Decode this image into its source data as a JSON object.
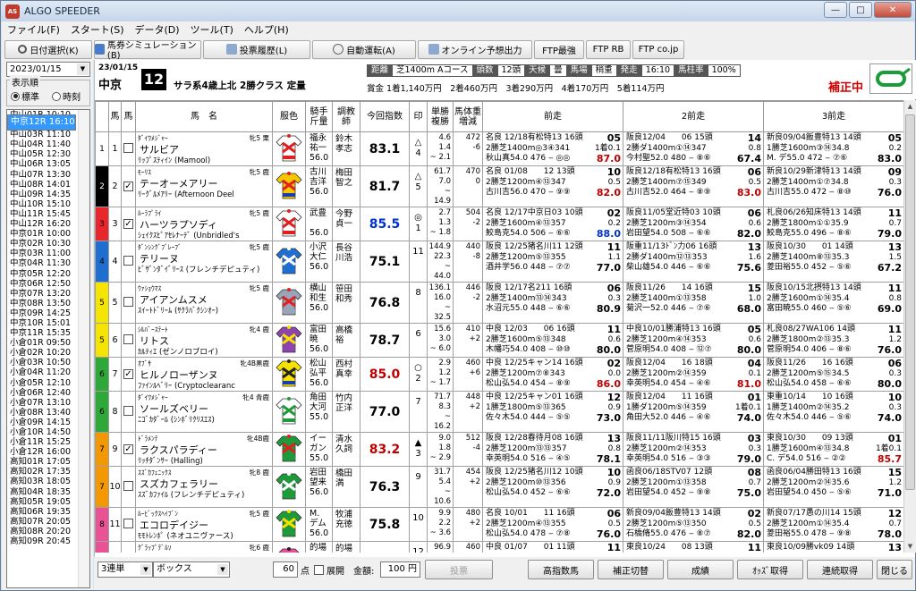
{
  "app": {
    "title": "ALGO SPEEDER",
    "icon_text": "AS"
  },
  "window_buttons": [
    "—",
    "□",
    "✕"
  ],
  "menu": [
    "ファイル(F)",
    "スタート(S)",
    "データ(D)",
    "ツール(T)",
    "ヘルプ(H)"
  ],
  "toolbar": [
    {
      "label": "日付選択(K)",
      "icon": "search-icon"
    },
    {
      "label": "馬券シミュレーション(B)",
      "icon": "table-icon"
    },
    {
      "label": "投票履歴(L)",
      "icon": "document-icon"
    },
    {
      "label": "自動運転(A)",
      "icon": "clock-icon"
    },
    {
      "label": "オンライン予想出力",
      "icon": "document-icon"
    },
    {
      "label": "FTP最強",
      "icon": ""
    },
    {
      "label": "FTP RB",
      "icon": ""
    },
    {
      "label": "FTP co.jp",
      "icon": ""
    }
  ],
  "left": {
    "date": "2023/01/15",
    "display_order_label": "表示順",
    "radio_standard": "標準",
    "radio_time": "時刻",
    "races": [
      "中山01R 10:10",
      "中山02R 10:40",
      "中山03R 11:10",
      "中山04R 11:40",
      "中山05R 12:30",
      "中山06R 13:05",
      "中山07R 13:30",
      "中山08R 14:01",
      "中山09R 14:35",
      "中山10R 15:10",
      "中山11R 15:45",
      "中山12R 16:20",
      "中京01R 10:00",
      "中京02R 10:30",
      "中京03R 11:00",
      "中京04R 11:30",
      "中京05R 12:20",
      "中京06R 12:50",
      "中京07R 13:20",
      "中京08R 13:50",
      "中京09R 14:25",
      "中京10R 15:01",
      "中京11R 15:35",
      "中京12R 16:10",
      "小倉01R 09:50",
      "小倉02R 10:20",
      "小倉03R 10:50",
      "小倉04R 11:20",
      "小倉05R 12:10",
      "小倉06R 12:40",
      "小倉07R 13:10",
      "小倉08R 13:40",
      "小倉09R 14:15",
      "小倉10R 14:50",
      "小倉11R 15:25",
      "小倉12R 16:00",
      "高知01R 17:05",
      "高知02R 17:35",
      "高知03R 18:05",
      "高知04R 18:35",
      "高知05R 19:05",
      "高知06R 19:35",
      "高知07R 20:05",
      "高知08R 20:20",
      "高知09R 20:45"
    ],
    "selected_index": 23
  },
  "race": {
    "date": "23/01/15",
    "place": "中京",
    "number": "12",
    "class": "サラ系4歳上北 2勝クラス 定量",
    "info": [
      {
        "t": "距離",
        "dark": true
      },
      {
        "t": "芝1400m Aコース",
        "dark": false
      },
      {
        "t": "頭数",
        "dark": true
      },
      {
        "t": "12頭",
        "dark": false
      },
      {
        "t": "天候",
        "dark": true
      },
      {
        "t": "曇",
        "dark": false
      },
      {
        "t": "馬場",
        "dark": true
      },
      {
        "t": "稍重",
        "dark": false
      },
      {
        "t": "発走",
        "dark": true
      },
      {
        "t": "16:10",
        "dark": false
      },
      {
        "t": "馬柱率",
        "dark": true
      },
      {
        "t": "100%",
        "dark": false
      }
    ],
    "prize": "賞金 1着1,140万円　2着460万円　3着290万円　4着170万円　5着114万円",
    "hosei": "補正中"
  },
  "columns": [
    "",
    "馬",
    "馬",
    "馬　名",
    "服色",
    "騎手\n斤量",
    "調教\n師",
    "今回指数",
    "印",
    "単勝\n複勝",
    "馬体重\n増減",
    "前走",
    "2前走",
    "3前走"
  ],
  "horses": [
    {
      "waku": "1",
      "num": "1",
      "chk": false,
      "sire": "ﾀﾞｲﾜﾒｼﾞｬｰ",
      "sex": "牝5 栗",
      "name": "サルビア",
      "sub": "ﾘｯﾌﾟｽﾃｨｲﾝ (Mamool)",
      "silk": "red-white",
      "jockey": "福永\n祐一\n56.0",
      "trainer": "鈴木\n孝志",
      "index": "83.1",
      "index_color": "pm",
      "mark": "△",
      "mark2": "4",
      "win": "4.6",
      "place": "1.4\n~ 2.1",
      "wt": "472\n-6",
      "p1": [
        "名良 12/18有松特13 16頭",
        "05",
        "2勝芝1400m◎3④341",
        "1着0.1",
        "秋山真54.0 476 ‒ ◎◎",
        "87.0"
      ],
      "p2": [
        "阪良12/04　　06 15頭",
        "14",
        "2勝ダ1400m①⑭347",
        "0.8",
        "今村聖52.0 480 ‒ ⑧⑥",
        "67.4"
      ],
      "p3": [
        "新良09/04飯豊特13 14頭",
        "05",
        "1勝芝1600m③⑭34.8",
        "0.2",
        "M. デ55.0 472 ‒ ⑦⑥",
        "83.0"
      ]
    },
    {
      "waku": "2",
      "num": "2",
      "chk": true,
      "sire": "ﾓｰﾘｽ",
      "sex": "牝5 鹿",
      "name": "テーオーメアリー",
      "sub": "ﾘｰｸﾞﾙﾒｱﾘｰ (Afternoon Deel",
      "silk": "yellow-red",
      "jockey": "古川\n吉洋\n56.0",
      "trainer": "梅田\n智之",
      "index": "81.7",
      "index_color": "pm",
      "mark": "△",
      "mark2": "5",
      "win": "61.7",
      "place": "7.0\n~ 14.9",
      "wt": "470\n0",
      "p1": [
        "名良 01/08　　12 13頭",
        "10",
        "2勝芝1200m④⑬347",
        "0.5",
        "古川吉56.0 470 ‒ ⑨⑨",
        "82.0"
      ],
      "p2": [
        "阪良12/18有松特13 16頭",
        "06",
        "2勝芝1400m⑦⑮349",
        "0.5",
        "古川吉52.0 464 ‒ ⑧⑨",
        "83.0"
      ],
      "p3": [
        "新良10/29新津特13 14頭",
        "09",
        "2勝芝1400m①⑦34.8",
        "0.3",
        "古川吉55.0 472 ‒ ⑧⑩",
        "76.0"
      ]
    },
    {
      "waku": "3",
      "num": "3",
      "chk": true,
      "sire": "ﾙｰﾗﾌﾟﾗｲ",
      "sex": "牝5 鹿",
      "name": "ハーツラプソディ",
      "sub": "ｼｪｲｸｽﾋﾟｱｾﾚﾅｰﾃﾞ (Unbridled's",
      "silk": "red-white-x",
      "jockey": "武豊\n\n56.0",
      "trainer": "今野\n貞一",
      "index": "85.5",
      "index_color": "bl",
      "mark": "◎",
      "mark2": "1",
      "win": "2.7",
      "place": "1.3\n~ 1.8",
      "wt": "504\n-2",
      "p1": [
        "名良 12/17中京日03 10頭",
        "02",
        "2勝芝1600m④⑬357",
        "0.2",
        "鮫島克54.0 506 ‒ ⑥⑥",
        "88.0"
      ],
      "p2": [
        "阪良11/05堂近特03 10頭",
        "06",
        "2勝芝1200m③⑭354",
        "0.6",
        "岩田望54.0 508 ‒ ⑥⑥",
        "82.0"
      ],
      "p3": [
        "札良06/26知床特13 14頭",
        "11",
        "2勝芝1800m①①35.9",
        "0.7",
        "鮫島克55.0 496 ‒ ⑧⑥",
        "79.0"
      ]
    },
    {
      "waku": "4",
      "num": "4",
      "chk": false,
      "sire": "ﾀﾞﾝｼﾝｸﾞﾌﾞﾚｰﾌﾞ",
      "sex": "牝5 鹿",
      "name": "テリーヌ",
      "sub": "ﾋﾞｻﾞﾝﾀﾞｲﾞﾘｰｽ (フレンチデピュティ)",
      "silk": "blue-white",
      "jockey": "小沢\n大仁\n56.0",
      "trainer": "長谷\n川浩",
      "index": "75.1",
      "index_color": "pm",
      "mark": "",
      "mark2": "11",
      "win": "144.9",
      "place": "22.3\n~ 44.0",
      "wt": "440\n-8",
      "p1": [
        "阪良 12/25猪名川11 12頭",
        "11",
        "2勝芝1200m⑤⑬355",
        "1.1",
        "酒井学56.0 448 ‒ ⑦⑦",
        "77.0"
      ],
      "p2": [
        "阪重11/13ﾄﾞﾝ力06 16頭",
        "13",
        "2勝ダ1400m⑫⑬353",
        "1.6",
        "柴山雄54.0 446 ‒ ⑥⑥",
        "75.6"
      ],
      "p3": [
        "阪良10/30　　01 14頭",
        "13",
        "2勝芝1400m⑧⑬35.3",
        "1.5",
        "菱田裕55.0 452 ‒ ⑤⑥",
        "67.2"
      ]
    },
    {
      "waku": "5",
      "num": "5",
      "chk": false,
      "sire": "ｳｧｼｮｳﾏｽ",
      "sex": "牝5 鹿",
      "name": "アイアンムスメ",
      "sub": "ｽｲｰﾄﾄﾞﾘｰﾑ (ｻｸﾗﾊﾞｸｼﾝｵｰ)",
      "silk": "grey-red",
      "jockey": "横山\n和生\n56.0",
      "trainer": "笹田\n和秀",
      "index": "76.8",
      "index_color": "pm",
      "mark": "",
      "mark2": "8",
      "win": "136.1",
      "place": "16.0\n~ 32.5",
      "wt": "446\n-2",
      "p1": [
        "阪良 12/17名211 16頭",
        "06",
        "2勝芝1400m⑬⑭343",
        "0.3",
        "水沼元55.0 448 ‒ ⑥⑥",
        "80.9"
      ],
      "p2": [
        "阪良11/26　　14 16頭",
        "15",
        "2勝芝1400m①⑬358",
        "1.0",
        "菊沢一52.0 446 ‒ ⑦⑥",
        "68.0"
      ],
      "p3": [
        "阪良10/15北摂特13 14頭",
        "11",
        "2勝芝1600m①⑭35.4",
        "0.8",
        "富田暁55.0 460 ‒ ⑤⑥",
        "69.0"
      ]
    },
    {
      "waku": "5",
      "num": "6",
      "chk": false,
      "sire": "ｼﾙﾊﾞｰｽﾃｰﾄ",
      "sex": "牝4 鹿",
      "name": "リトス",
      "sub": "ｶﾙﾃｨｴ (ゼンノロブロイ)",
      "silk": "purple-yellow",
      "jockey": "富田\n暁\n56.0",
      "trainer": "高橋\n裕",
      "index": "78.7",
      "index_color": "pm",
      "mark": "",
      "mark2": "6",
      "win": "15.6",
      "place": "3.0\n~ 6.0",
      "wt": "410\n+2",
      "p1": [
        "中良 12/03　　06 16頭",
        "11",
        "2勝芝1600m⑤⑬348",
        "0.6",
        "木幡巧54.0 408 ‒ ⑩⑩",
        "80.0"
      ],
      "p2": [
        "中良10/01勝浦特13 16頭",
        "05",
        "2勝芝1200m④⑭353",
        "0.6",
        "菅原明54.0 408 ‒ ⑫⑦",
        "80.0"
      ],
      "p3": [
        "札良08/27WA106 14頭",
        "11",
        "2勝芝1800m②⑬35.3",
        "1.2",
        "菅原明54.0 406 ‒ ⑧⑥",
        "76.0"
      ]
    },
    {
      "waku": "6",
      "num": "7",
      "chk": true,
      "sire": "ｵﾌﾞｻ",
      "sex": "牝4B黒鹿",
      "name": "ヒルノローザンヌ",
      "sub": "ﾌｧｲﾝﾙﾍﾞﾘｰ (Cryptoclearanc",
      "silk": "yellow-black",
      "jockey": "松山\n弘平\n56.0",
      "trainer": "西村\n真幸",
      "index": "85.0",
      "index_color": "rd",
      "mark": "○",
      "mark2": "2",
      "win": "2.9",
      "place": "1.2\n~ 1.7",
      "wt": "460\n+6",
      "p1": [
        "中良 12/25キャン14 16頭",
        "02",
        "2勝芝1200m⑦⑧343",
        "0.0",
        "松山弘54.0 454 ‒ ⑧⑨",
        "86.0"
      ],
      "p2": [
        "阪良12/04　　16 18頭",
        "04",
        "2勝芝1200m②⑭359",
        "0.1",
        "幸英明54.0 454 ‒ ④⑥",
        "81.0"
      ],
      "p3": [
        "阪良11/26　　16 16頭",
        "06",
        "2勝芝1200m⑤⑮34.5",
        "0.3",
        "松山弘54.0 458 ‒ ⑥⑥",
        "80.0"
      ]
    },
    {
      "waku": "6",
      "num": "8",
      "chk": false,
      "sire": "ﾀﾞｲﾜﾒｼﾞｬｰ",
      "sex": "牝4 青鹿",
      "name": "ソールズベリー",
      "sub": "ﾆｺﾞｶﾀﾞｰﾙ (ｼﾝﾎﾞﾘｸﾘｽｴｽ)",
      "silk": "green-white",
      "jockey": "角田\n大河\n55.0",
      "trainer": "竹内\n正洋",
      "index": "77.0",
      "index_color": "pm",
      "mark": "",
      "mark2": "7",
      "win": "71.7",
      "place": "8.3\n~ 16.2",
      "wt": "448\n+2",
      "p1": [
        "中良 12/25キャン01 16頭",
        "12",
        "1勝芝1800m⑤⑬365",
        "0.9",
        "佐々木54.0 444 ‒ ⑤⑤",
        "73.0"
      ],
      "p2": [
        "阪良12/04　　11 16頭",
        "01",
        "1勝ダ1200m⑤⑭359",
        "1着0.1",
        "角田大52.0 446 ‒ ④⑥",
        "74.0"
      ],
      "p3": [
        "東重10/14　　10 16頭",
        "10",
        "1勝芝1400m②⑭35.2",
        "0.3",
        "佐々木54.0 446 ‒ ⑤⑥",
        "74.0"
      ]
    },
    {
      "waku": "7",
      "num": "9",
      "chk": true,
      "sire": "ﾄﾞﾗﾒﾝﾃ",
      "sex": "牝4B鹿",
      "name": "ラクスパラディー",
      "sub": "ﾘｯﾁﾀﾞﾝｻｰ (Halling)",
      "silk": "green-red",
      "jockey": "イー\nガン\n55.0",
      "trainer": "清水\n久詞",
      "index": "83.2",
      "index_color": "rd",
      "mark": "▲",
      "mark2": "3",
      "win": "9.0",
      "place": "1.8\n~ 2.9",
      "wt": "512\n-4",
      "p1": [
        "阪良 12/28春待月08 16頭",
        "13",
        "2勝芝1200m⑬⑬357",
        "0.8",
        "幸英明54.0 516 ‒ ④⑤",
        "78.1"
      ],
      "p2": [
        "阪良11/11阪川特15 16頭",
        "03",
        "2勝芝1200m②⑭353",
        "0.3",
        "幸英明54.0 516 ‒ ③③",
        "79.0"
      ],
      "p3": [
        "東良10/30　　09 13頭",
        "01",
        "1勝芝1600m④⑬34.8",
        "1着0.1",
        "C. デ54.0 516 ‒ ②②",
        "85.7"
      ]
    },
    {
      "waku": "7",
      "num": "10",
      "chk": false,
      "sire": "ｽｽﾞｶﾌｪﾆｯｸｽ",
      "sex": "牝8 鹿",
      "name": "スズカフェラリー",
      "sub": "ｽｽﾞｶﾌｧｲﾙ (フレンチデピュティ)",
      "silk": "green-white2",
      "jockey": "岩田\n望来\n56.0",
      "trainer": "橋田\n満",
      "index": "76.3",
      "index_color": "pm",
      "mark": "",
      "mark2": "9",
      "win": "31.7",
      "place": "5.4\n~ 10.6",
      "wt": "454\n+2",
      "p1": [
        "阪良 12/25猪名川12 10頭",
        "10",
        "2勝芝1200m⑩⑬356",
        "0.9",
        "松山弘54.0 452 ‒ ⑥⑥",
        "72.0"
      ],
      "p2": [
        "函良06/18STV07 12頭",
        "08",
        "2勝芝1200m①⑬358",
        "0.7",
        "岩田望54.0 452 ‒ ⑨⑧",
        "75.0"
      ],
      "p3": [
        "函良06/04勝田特13 16頭",
        "15",
        "2勝芝1200m②⑭35.6",
        "1.2",
        "岩田望54.0 450 ‒ ⑤⑥",
        "71.0"
      ]
    },
    {
      "waku": "8",
      "num": "11",
      "chk": false,
      "sire": "ﾙｰﾋﾞｯｸｽﾍｲﾌﾞﾝ",
      "sex": "牝5 鹿",
      "name": "エコロデイジー",
      "sub": "ﾓﾓﾄﾚﾝﾎﾟ (ネオユニヴァース)",
      "silk": "green-yellow",
      "jockey": "M.\nデム\n56.0",
      "trainer": "牧浦\n充徳",
      "index": "75.8",
      "index_color": "pm",
      "mark": "",
      "mark2": "10",
      "win": "9.9",
      "place": "2.2\n~ 3.6",
      "wt": "480\n+2",
      "p1": [
        "名良 10/01　　11 16頭",
        "06",
        "2勝芝1200m④⑬355",
        "0.5",
        "松山弘54.0 478 ‒ ⑦⑧",
        "76.0"
      ],
      "p2": [
        "新良09/04飯豊特13 14頭",
        "02",
        "2勝芝1200m⑤⑬350",
        "0.5",
        "石橋脩55.0 476 ‒ ⑧⑦",
        "82.0"
      ],
      "p3": [
        "新良07/17愚の川14 15頭",
        "12",
        "2勝芝1200m①⑭35.4",
        "0.7",
        "菱田裕55.0 478 ‒ ⑨⑧",
        "78.0"
      ]
    },
    {
      "waku": "8",
      "num": "12",
      "chk": false,
      "sire": "ｸﾞﾗｯﾌﾟﾃﾞﾙｿ",
      "sex": "牝6 鹿",
      "name": "ミズリーナ",
      "sub": "ｶﾉﾝ (フォーティナイナーズサン)",
      "silk": "pink-black",
      "jockey": "的場\n勇人\n56.0",
      "trainer": "的場\n均",
      "index": "74.0",
      "index_color": "pm",
      "mark": "",
      "mark2": "12",
      "win": "96.9",
      "place": "13.9\n~ 25.7",
      "wt": "460\n+4",
      "p1": [
        "中良 01/07　　01 11頭",
        "11",
        "2勝芝1200m⑬⑬350",
        "0.9",
        "的場勇54.0 456 ‒ ⑪⑪",
        "77.0"
      ],
      "p2": [
        "東良10/24　　08 13頭",
        "11",
        "2勝芝1400m⑭⑬356",
        "1.2",
        "的場勇55.0 456 ‒ ⑫⑪",
        "76.0"
      ],
      "p3": [
        "東良10/09勝vk09 14頭",
        "13",
        "2勝芝1600m①⑩35.5",
        "1.3",
        "的場勇55.0 454 ‒ ⑩⑫",
        "74.0"
      ]
    }
  ],
  "bottom": {
    "bet_type": "3連単",
    "bet_method": "ボックス",
    "points_value": "60",
    "points_label": "点",
    "expand_label": "展開",
    "amount_label": "金額:",
    "amount_value": "100 円",
    "vote_btn": "投票",
    "buttons": [
      "高指数馬",
      "補正切替",
      "成績",
      "ｵｯｽﾞ取得",
      "連続取得",
      "閉じる"
    ]
  },
  "colors": {
    "selected": "#3399ff",
    "highlight_red": "#c00000",
    "highlight_blue": "#0033cc"
  },
  "waku_colors": {
    "1": "#ffffff",
    "2": "#000000",
    "3": "#e8262b",
    "4": "#1e6fd0",
    "5": "#f4e400",
    "6": "#2fa83a",
    "7": "#f39800",
    "8": "#e95295"
  }
}
